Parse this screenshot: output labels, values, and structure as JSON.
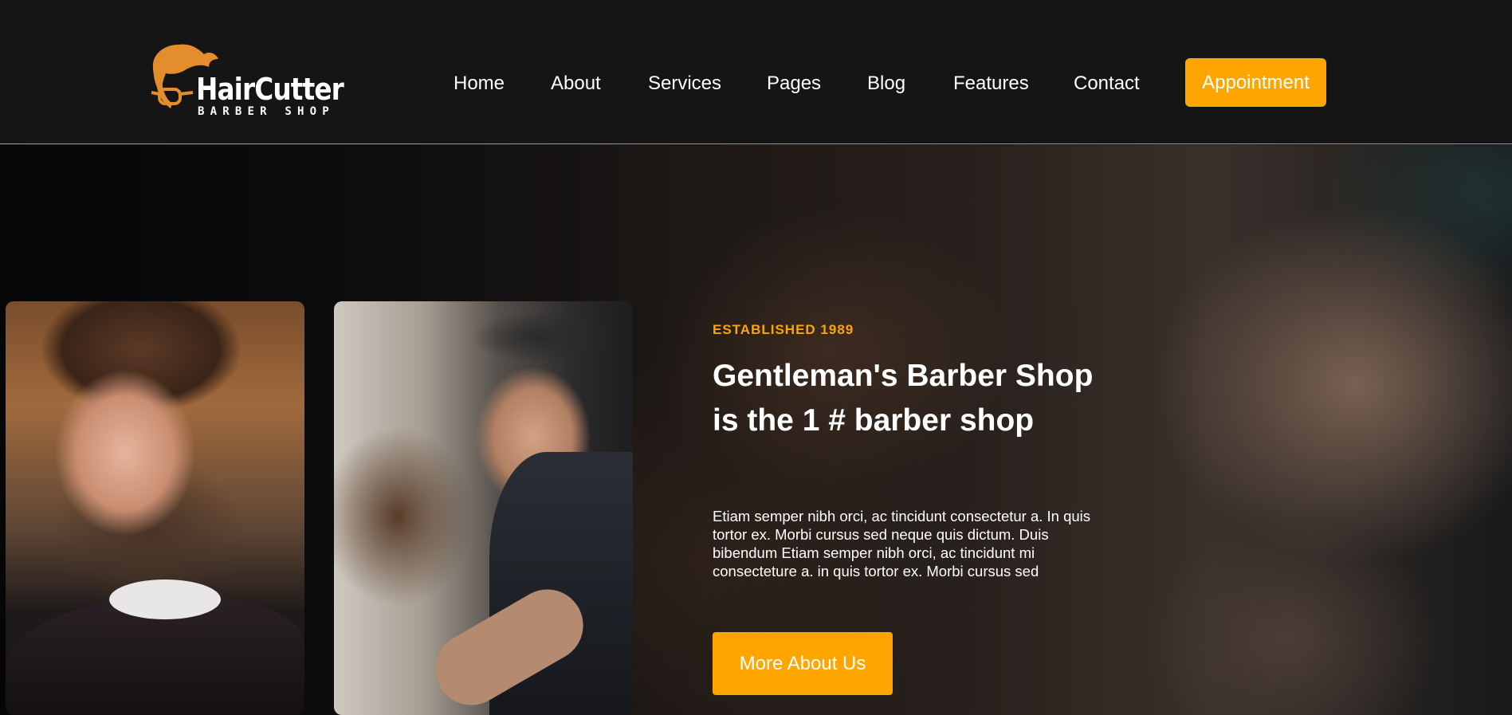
{
  "header": {
    "logo": {
      "name": "HairCutter",
      "tagline": "BARBER SHOP",
      "mark_icon": "barber-hair-glasses-icon",
      "brand_color": "#e38d2d"
    },
    "nav": [
      {
        "label": "Home"
      },
      {
        "label": "About"
      },
      {
        "label": "Services"
      },
      {
        "label": "Pages"
      },
      {
        "label": "Blog"
      },
      {
        "label": "Features"
      },
      {
        "label": "Contact"
      }
    ],
    "cta_label": "Appointment"
  },
  "hero": {
    "eyebrow": "ESTABLISHED 1989",
    "headline": "Gentleman's Barber Shop is the 1 # barber shop",
    "description": "Etiam semper nibh orci, ac tincidunt consectetur a. In quis tortor ex. Morbi cursus sed neque quis dictum. Duis bibendum Etiam semper nibh orci, ac tincidunt mi consecteture a. in quis tortor ex. Morbi cursus sed",
    "button_label": "More About Us"
  },
  "colors": {
    "accent": "#ffa500",
    "header_bg": "#151515",
    "text": "#ffffff"
  }
}
